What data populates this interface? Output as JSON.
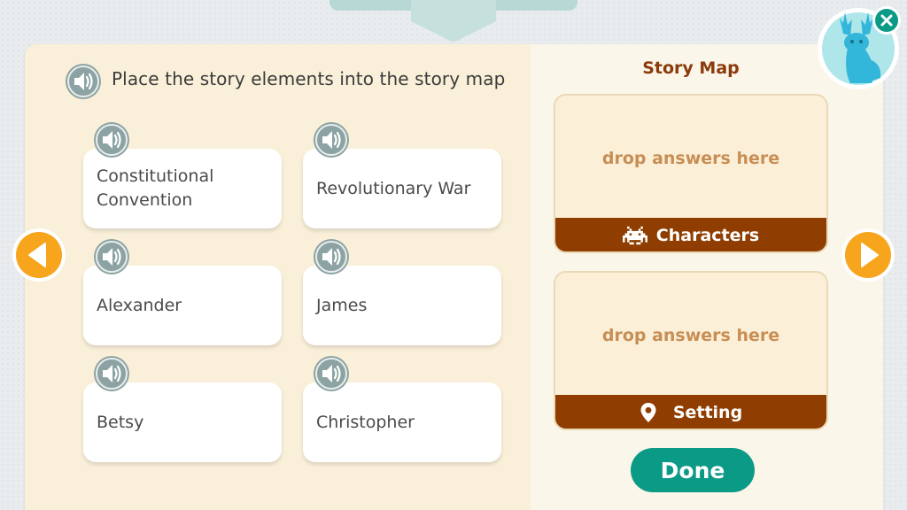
{
  "instruction": "Place the story elements into the story map",
  "answers": [
    "Constitutional Convention",
    "Revolutionary War",
    "Alexander",
    "James",
    "Betsy",
    "Christopher"
  ],
  "story_map": {
    "title": "Story Map",
    "zones": [
      {
        "placeholder": "drop answers here",
        "label": "Characters",
        "icon": "alien-character-icon"
      },
      {
        "placeholder": "drop answers here",
        "label": "Setting",
        "icon": "location-pin-icon"
      }
    ]
  },
  "done_label": "Done",
  "icons": {
    "audio": "speaker-icon",
    "prev": "arrow-left-icon",
    "next": "arrow-right-icon",
    "close": "close-icon",
    "avatar": "deer-avatar-icon"
  },
  "colors": {
    "accent_orange": "#f7a51d",
    "brown": "#8f3d00",
    "done_green": "#0b9a86",
    "audio_gray": "#8da3a3"
  }
}
